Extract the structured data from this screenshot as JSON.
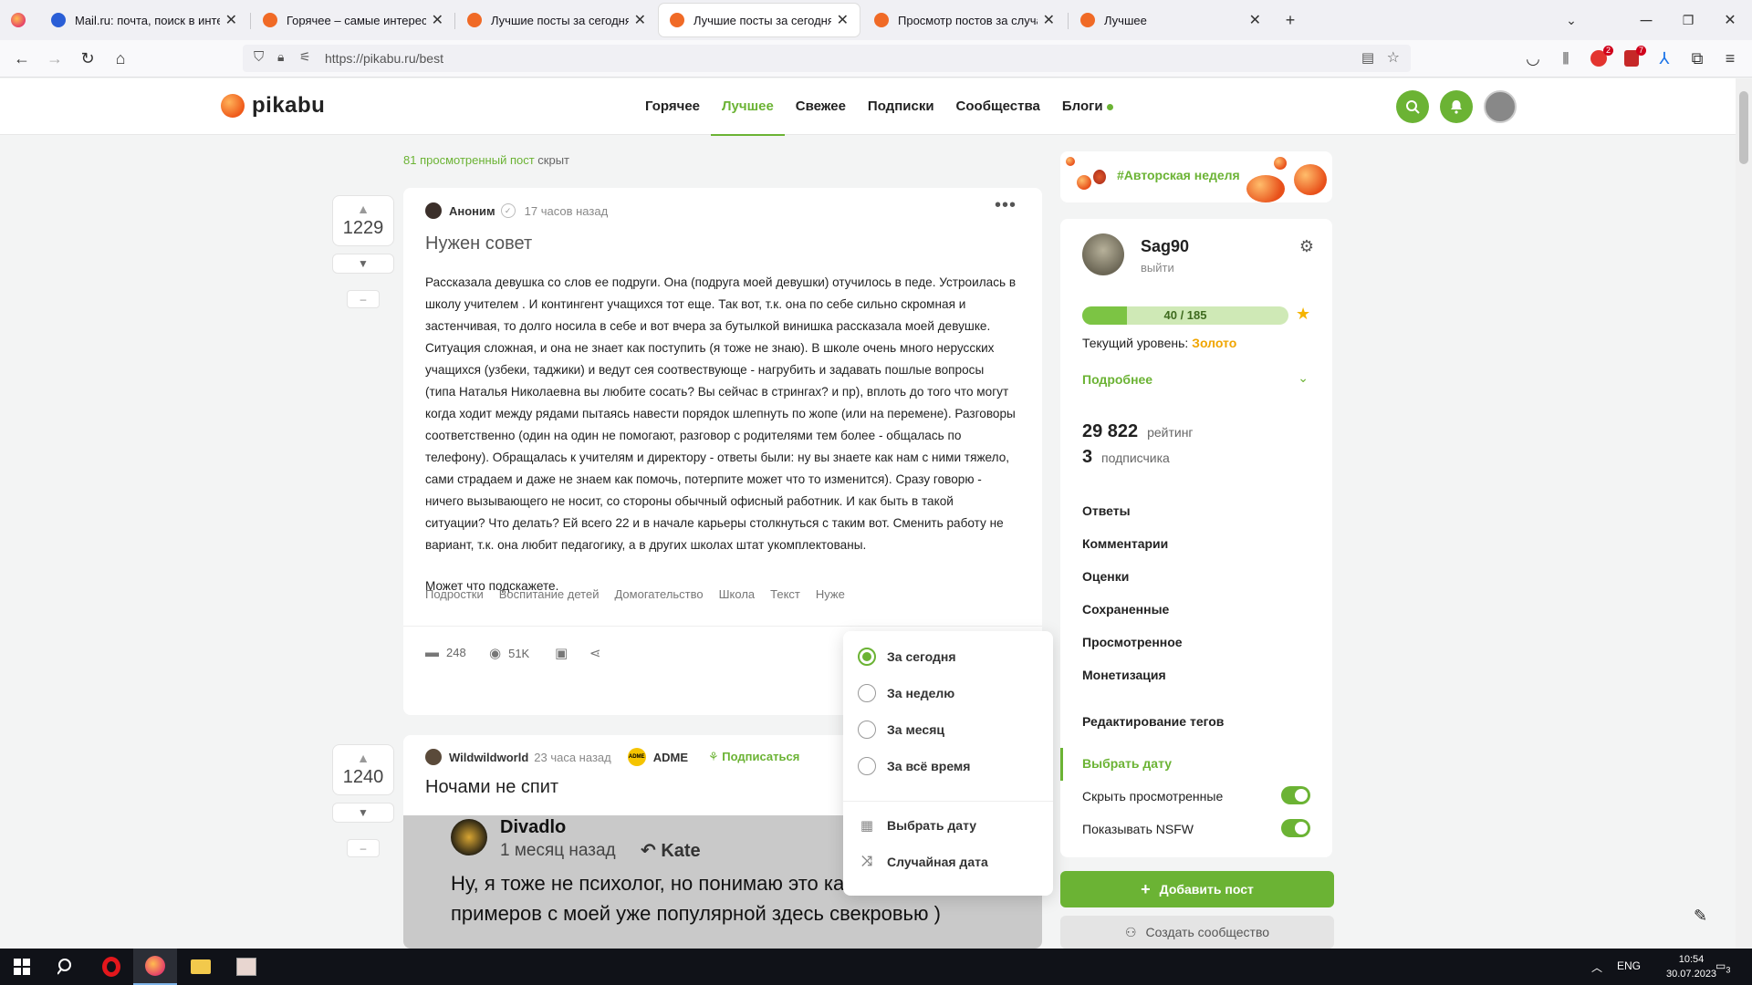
{
  "browser": {
    "tabs": [
      {
        "title": "Mail.ru: почта, поиск в интерне",
        "close": "✕",
        "favicon_color": "#2a5ed6"
      },
      {
        "title": "Горячее – самые интересные",
        "close": "✕",
        "favicon_color": "#f06a26"
      },
      {
        "title": "Лучшие посты за сегодня | Пи",
        "close": "✕",
        "favicon_color": "#f06a26"
      },
      {
        "title": "Лучшие посты за сегодня | Пи",
        "close": "✕",
        "favicon_color": "#f06a26",
        "active": true
      },
      {
        "title": "Просмотр постов за случайну",
        "close": "✕",
        "favicon_color": "#f06a26"
      },
      {
        "title": "Лучшее",
        "close": "✕",
        "favicon_color": "#f06a26"
      }
    ],
    "new_tab": "+",
    "url": "https://pikabu.ru/best",
    "badges": {
      "adblock": "2",
      "extension": "7"
    }
  },
  "site": {
    "logo_text": "pikabu",
    "menu": [
      "Горячее",
      "Лучшее",
      "Свежее",
      "Подписки",
      "Сообщества",
      "Блоги"
    ],
    "active_menu": "Лучшее",
    "accent_color": "#6bb334"
  },
  "feed": {
    "hidden_note_link": "81 просмотренный пост",
    "hidden_note_rest": "скрыт",
    "posts": [
      {
        "votes": "1229",
        "minus": "–",
        "author": "Аноним",
        "time": "17 часов назад",
        "title": "Нужен совет",
        "body": [
          "Рассказала девушка со слов ее подруги. Она (подруга моей девушки) отучилось в педе. Устроилась в школу учителем . И контингент учащихся тот еще. Так вот, т.к. она по себе сильно скромная и застенчивая, то долго носила в себе и вот вчера за бутылкой винишка рассказала моей девушке. Ситуация сложная, и она не знает как поступить (я тоже не знаю). В школе очень много нерусских учащихся (узбеки, таджики) и ведут сея соотвествующе - нагрубить и задавать пошлые вопросы (типа Наталья Николаевна вы любите сосать? Вы сейчас в стрингах? и пр), вплоть до того что могут когда ходит между рядами пытаясь навести порядок шлепнуть по жопе (или на перемене). Разговоры соответственно (один на один не помогают, разговор с родителями тем более - общалась по телефону). Обращалась к учителям и директору - ответы были: ну вы знаете как нам с ними тяжело, сами страдаем и даже не знаем как помочь, потерпите может что то изменится). Сразу говорю - ничего вызывающего не носит, со стороны обычный офисный работник. И как быть в такой ситуации? Что делать? Ей всего 22 и в начале карьеры столкнуться с таким вот. Сменить работу не вариант, т.к. она любит педагогику, а в других школах штат укомплектованы.",
          "Может что подскажете."
        ],
        "tags": [
          "Подростки",
          "Воспитание детей",
          "Домогательство",
          "Школа",
          "Текст",
          "Нуже"
        ],
        "comments": "248",
        "views": "51K"
      },
      {
        "votes": "1240",
        "minus": "–",
        "author": "Wildwildworld",
        "time": "23 часа назад",
        "community": "ADME",
        "community_logo": "ADME",
        "subscribe": "Подписаться",
        "title": "Ночами не спит",
        "screenshot": {
          "name": "Divadlo",
          "time": "1 месяц назад",
          "reply_to": "Kate",
          "text": "Ну, я тоже не психолог, но понимаю это как в одном из примеров с моей уже популярной здесь свекровью )"
        }
      }
    ]
  },
  "period_dropdown": {
    "options": [
      "За сегодня",
      "За неделю",
      "За месяц",
      "За всё время"
    ],
    "selected": "За сегодня",
    "pick_date": "Выбрать дату",
    "random_date": "Случайная дата"
  },
  "sidebar": {
    "banner": "#Авторская неделя",
    "profile": {
      "username": "Sag90",
      "logout": "выйти",
      "progress_text": "40 / 185",
      "progress_fraction": 0.216,
      "level_label": "Текущий уровень:",
      "level_value": "Золото",
      "more": "Подробнее",
      "rating_value": "29 822",
      "rating_label": "рейтинг",
      "subs_value": "3",
      "subs_label": "подписчика"
    },
    "links": [
      "Ответы",
      "Комментарии",
      "Оценки",
      "Сохраненные",
      "Просмотренное",
      "Монетизация"
    ],
    "edit_tags": "Редактирование тегов",
    "pick_date": "Выбрать дату",
    "toggles": [
      {
        "label": "Скрыть просмотренные",
        "on": true
      },
      {
        "label": "Показывать NSFW",
        "on": true
      }
    ],
    "add_post": "Добавить пост",
    "create_community": "Создать сообщество"
  },
  "taskbar": {
    "lang": "ENG",
    "time": "10:54",
    "date": "30.07.2023",
    "notifications": "3"
  }
}
